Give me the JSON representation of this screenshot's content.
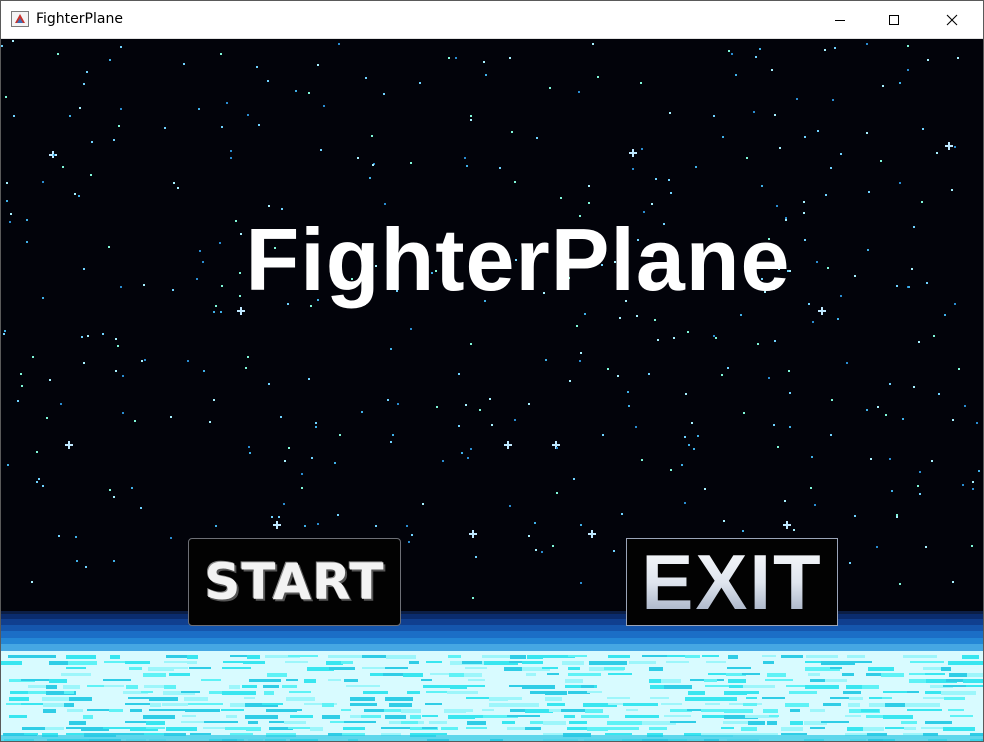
{
  "window": {
    "title": "FighterPlane",
    "icon": "java-app-icon",
    "controls": [
      "minimize-icon",
      "maximize-icon",
      "close-icon"
    ]
  },
  "game": {
    "title": "FighterPlane",
    "buttons": {
      "start_label": "START",
      "exit_label": "EXIT"
    },
    "colors": {
      "sky": "#02030a",
      "star": "#9ce3ff",
      "horizon_dark": "#0a2a6b",
      "horizon_mid": "#1e7fd0",
      "sea_light": "#d9fbff",
      "sea_cyan": "#39e8f0"
    }
  }
}
